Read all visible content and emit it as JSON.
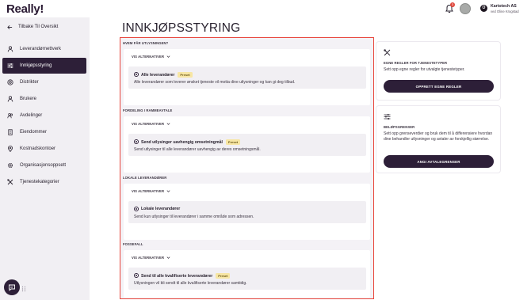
{
  "app": {
    "logo": "Really!"
  },
  "header": {
    "notification_count": "3",
    "user": {
      "initial": "O",
      "company": "Kartotech AS",
      "subtitle": "ved Oline Krogstad"
    }
  },
  "sidebar": {
    "back_label": "Tilbake Til Oversikt",
    "items": [
      {
        "label": "Leverandørnettverk",
        "icon": "person-icon",
        "active": false
      },
      {
        "label": "Innkjøpsstyring",
        "icon": "sliders-icon",
        "active": true
      },
      {
        "label": "Distrikter",
        "icon": "target-icon",
        "active": false
      },
      {
        "label": "Brukere",
        "icon": "user-icon",
        "active": false
      },
      {
        "label": "Avdelinger",
        "icon": "team-icon",
        "active": false
      },
      {
        "label": "Eiendommer",
        "icon": "building-icon",
        "active": false
      },
      {
        "label": "Kostnadskontoer",
        "icon": "location-pin-icon",
        "active": false
      },
      {
        "label": "Organisasjonsoppsett",
        "icon": "gear-icon",
        "active": false
      },
      {
        "label": "Tjenestekategorier",
        "icon": "tools-icon",
        "active": false
      }
    ]
  },
  "main": {
    "title": "INNKJØPSSTYRING",
    "sections": [
      {
        "label": "HVEM FÅR UTLYSNINGEN?",
        "toggle": "VIS ALTERNATIVER",
        "option": {
          "title": "Alle leverandører",
          "badge": "Preset",
          "description": "Alle leverandører som leverer ønsket tjeneste vil motta dine utlysninger og kan gi deg tilbud."
        }
      },
      {
        "label": "FORDELING I RAMMEAVTALE",
        "toggle": "VIS ALTERNATIVER",
        "option": {
          "title": "Send utlysinger uavhengig omsetningmål",
          "badge": "Preset",
          "description": "Send utlysinger til alle leverandører uavhengig av deres omsetningsmål."
        }
      },
      {
        "label": "LOKALE LEVERANDØRER",
        "toggle": "VIS ALTERNATIVER",
        "option": {
          "title": "Lokale leverandører",
          "badge": "",
          "description": "Send kun utlysinger til leverandører i samme område som adressen."
        }
      },
      {
        "label": "FOSSEFALL",
        "toggle": "VIS ALTERNATIVER",
        "option": {
          "title": "Send til alle kvalifiserte leverandører",
          "badge": "Preset",
          "description": "Utlysningen vil bli sendt til alle kvalifiserte leverandører samtidig."
        }
      }
    ]
  },
  "side_cards": [
    {
      "icon": "tools-icon",
      "heading": "EGNE REGLER FOR TJENESTETYPER",
      "text": "Sett opp egne regler for utvalgte tjenestetyper.",
      "button": "OPPRETT EGNE REGLER"
    },
    {
      "icon": "sliders-icon",
      "heading": "BELØPSGRENSER",
      "text": "Sett opp grenseverdier og bruk dem til å differensiere hvordan dine behandler utlysninger og avtaler av forskjellig størrelse.",
      "button": "ANGI AVTALEGRENSER"
    }
  ],
  "colors": {
    "brand": "#2d1f38",
    "highlight": "#e8453c",
    "badge": "#f7e6a4"
  }
}
